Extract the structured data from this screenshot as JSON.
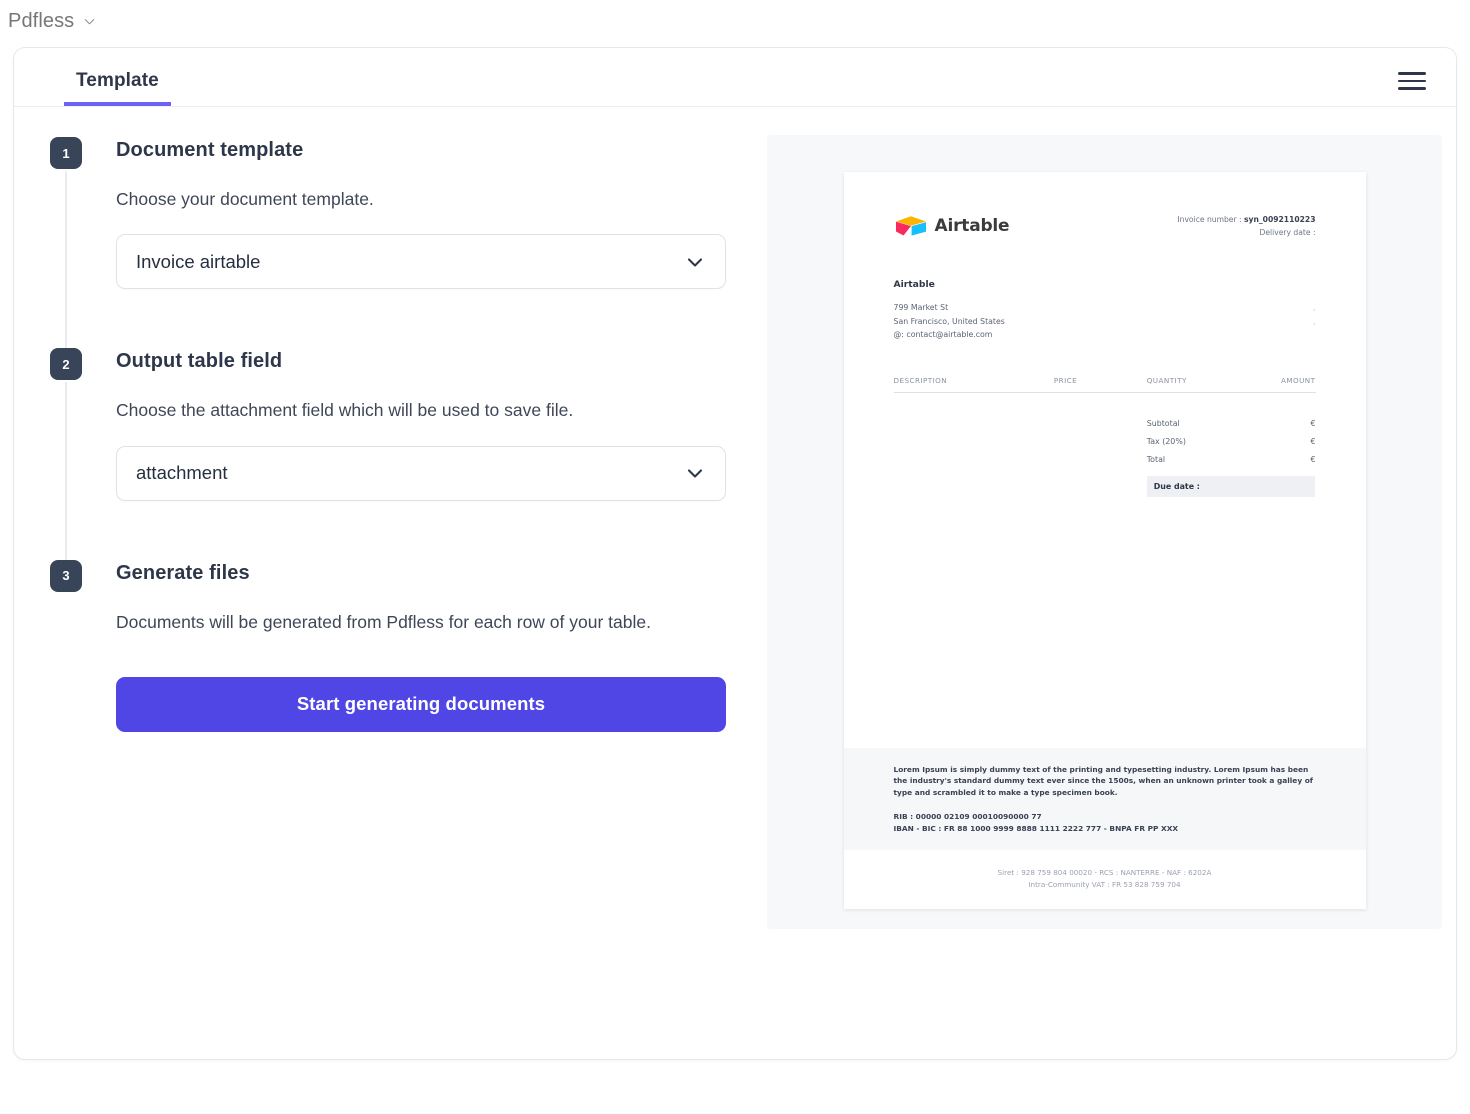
{
  "topbar": {
    "app_name": "Pdfless",
    "chevron_icon": "chevron-down-icon"
  },
  "card": {
    "tabs": [
      {
        "label": "Template",
        "active": true
      }
    ],
    "menu_icon": "hamburger-menu-icon"
  },
  "steps": [
    {
      "number": "1",
      "title": "Document template",
      "description": "Choose your document template.",
      "select": {
        "value": "Invoice airtable",
        "chevron_icon": "chevron-down-icon"
      }
    },
    {
      "number": "2",
      "title": "Output table field",
      "description": "Choose the attachment field which will be used to save file.",
      "select": {
        "value": "attachment",
        "chevron_icon": "chevron-down-icon"
      }
    },
    {
      "number": "3",
      "title": "Generate files",
      "description": "Documents will be generated from Pdfless for each row of your table.",
      "button_label": "Start generating documents"
    }
  ],
  "preview": {
    "brand": {
      "name": "Airtable",
      "logo_icon": "airtable-logo-icon"
    },
    "meta": {
      "invoice_number_label": "Invoice number : ",
      "invoice_number_value": "syn_0092110223",
      "delivery_date_label": "Delivery date :"
    },
    "from": {
      "company": "Airtable",
      "address_line1": "799 Market St",
      "address_line2": "San Francisco, United States",
      "email_line": "@: contact@airtable.com"
    },
    "to": {
      "line1": ",",
      "line2": ","
    },
    "table": {
      "headers": [
        "DESCRIPTION",
        "PRICE",
        "QUANTITY",
        "AMOUNT"
      ],
      "rows": []
    },
    "totals": [
      {
        "label": "Subtotal",
        "value": "€"
      },
      {
        "label": "Tax (20%)",
        "value": "€"
      },
      {
        "label": "Total",
        "value": "€"
      }
    ],
    "due_date_label": "Due date :",
    "footer": {
      "lorem": "Lorem Ipsum is simply dummy text of the printing and typesetting industry. Lorem Ipsum has been the industry's standard dummy text ever since the 1500s, when an unknown printer took a galley of type and scrambled it to make a type specimen book.",
      "rib": "RIB : 00000 02109 00010090000 77",
      "iban": "IBAN - BIC : FR 88 1000 9999 8888 1111 2222 777 - BNPA FR PP XXX",
      "legal_line1": "Siret : 928 759 804 00020 - RCS : NANTERRE - NAF : 6202A",
      "legal_line2": "Intra-Community VAT : FR 53 828 759 704"
    }
  },
  "colors": {
    "accent": "#4f46e5",
    "tab_underline": "#6c63f5",
    "badge": "#384559",
    "text_dark": "#2e374a"
  }
}
